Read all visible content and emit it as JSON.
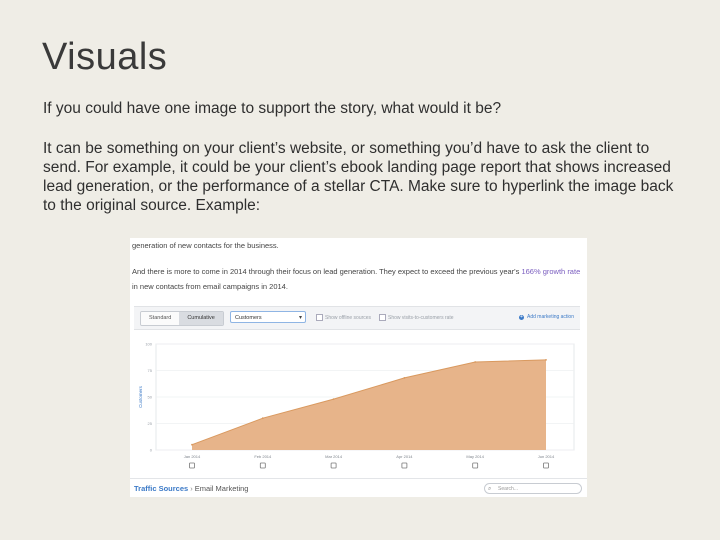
{
  "slide": {
    "title": "Visuals",
    "paragraph_1": "If you could have one image to support the story, what would it be?",
    "paragraph_2": "It can be something on your client’s website, or something you’d have to ask the client to send. For example, it could be your client’s ebook landing page report that shows increased lead generation, or the performance of a stellar CTA.  Make sure to hyperlink the image back to the original source. Example:"
  },
  "screenshot": {
    "intro_line": "generation of new contacts for the business.",
    "line_2_before": "And there is more to come in 2014 through their focus on lead generation. They expect to exceed the previous year's ",
    "line_2_highlight": "166% growth rate",
    "line_3": "in new contacts from email campaigns in 2014.",
    "toolbar": {
      "tab_standard": "Standard",
      "tab_cumulative": "Cumulative",
      "metric_select": "Customers",
      "checkbox_1": "Show offline sources",
      "checkbox_2": "Show visits-to-customers rate",
      "add_action": "Add marketing action"
    },
    "footer": {
      "crumb_link": "Traffic Sources",
      "crumb_sep": "›",
      "crumb_current": "Email Marketing",
      "search_placeholder": "Search..."
    }
  },
  "colors": {
    "background": "#efede6",
    "area_fill": "#e7b48a",
    "area_stroke": "#d9995f",
    "link": "#3c7ac7"
  },
  "chart_data": {
    "type": "area",
    "ylabel": "Customers",
    "yticks": [
      "0",
      "25",
      "50",
      "75",
      "100"
    ],
    "ylim": [
      0,
      100
    ],
    "x": [
      "Jan 2014",
      "Feb 2014",
      "Mar 2014",
      "Apr 2014",
      "May 2014",
      "Jun 2014"
    ],
    "xtick_labels": [
      "Jan 2014",
      "Feb 2014",
      "Mar 2014",
      "Apr 2014",
      "May 2014",
      "Jun 2014"
    ],
    "series": [
      {
        "values": [
          5,
          30,
          48,
          68,
          83,
          85
        ]
      }
    ],
    "legend": "none",
    "grid": true
  }
}
